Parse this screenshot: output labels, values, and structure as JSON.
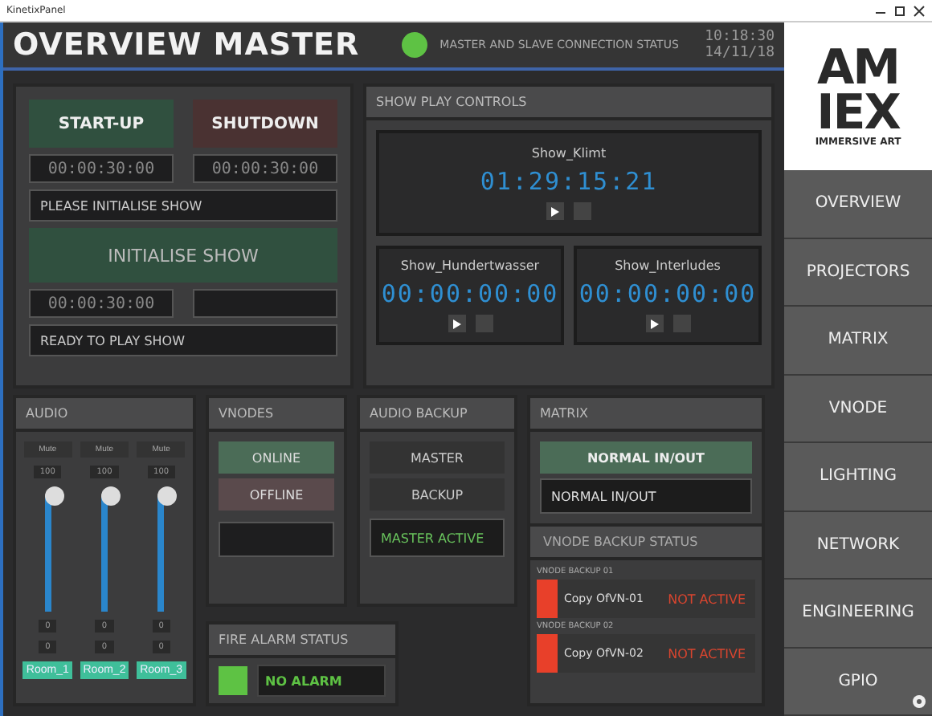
{
  "window": {
    "title": "KinetixPanel"
  },
  "header": {
    "title": "OVERVIEW MASTER",
    "connection_label": "MASTER AND SLAVE CONNECTION STATUS",
    "connected": true,
    "time": "10:18:30",
    "date": "14/11/18"
  },
  "logo": {
    "line1": "AM",
    "line2": "IEX",
    "tagline": "IMMERSIVE ART"
  },
  "nav": [
    {
      "label": "OVERVIEW",
      "selected": false
    },
    {
      "label": "PROJECTORS",
      "selected": false
    },
    {
      "label": "MATRIX",
      "selected": false
    },
    {
      "label": "VNODE",
      "selected": false
    },
    {
      "label": "LIGHTING",
      "selected": false
    },
    {
      "label": "NETWORK",
      "selected": false
    },
    {
      "label": "ENGINEERING",
      "selected": false
    },
    {
      "label": "GPIO",
      "selected": false
    }
  ],
  "power": {
    "startup": {
      "label": "START-UP",
      "timer": "00:00:30:00"
    },
    "shutdown": {
      "label": "SHUTDOWN",
      "timer": "00:00:30:00"
    },
    "message": "PLEASE INITIALISE SHOW",
    "initialise": {
      "label": "INITIALISE SHOW",
      "timer": "00:00:30:00"
    },
    "status": "READY TO PLAY SHOW"
  },
  "show_play": {
    "title": "SHOW PLAY CONTROLS",
    "shows": [
      {
        "name": "Show_Klimt",
        "timecode": "01:29:15:21"
      },
      {
        "name": "Show_Hundertwasser",
        "timecode": "00:00:00:00"
      },
      {
        "name": "Show_Interludes",
        "timecode": "00:00:00:00"
      }
    ]
  },
  "audio": {
    "title": "AUDIO",
    "channels": [
      {
        "mute": "Mute",
        "max": "100",
        "level": 1,
        "value": "0",
        "gain": "0",
        "name": "Room_1"
      },
      {
        "mute": "Mute",
        "max": "100",
        "level": 1,
        "value": "0",
        "gain": "0",
        "name": "Room_2"
      },
      {
        "mute": "Mute",
        "max": "100",
        "level": 1,
        "value": "0",
        "gain": "0",
        "name": "Room_3"
      }
    ]
  },
  "vnodes": {
    "title": "VNODES",
    "online": "ONLINE",
    "offline": "OFFLINE"
  },
  "audio_backup": {
    "title": "AUDIO BACKUP",
    "master": "MASTER",
    "backup": "BACKUP",
    "status": "MASTER ACTIVE"
  },
  "matrix": {
    "title": "MATRIX",
    "button": "NORMAL IN/OUT",
    "status": "NORMAL IN/OUT"
  },
  "vnode_backup": {
    "title": "VNODE BACKUP STATUS",
    "items": [
      {
        "label": "VNODE BACKUP 01",
        "name": "Copy OfVN-01",
        "status": "NOT ACTIVE",
        "color": "#e8402a"
      },
      {
        "label": "VNODE BACKUP 02",
        "name": "Copy OfVN-02",
        "status": "NOT ACTIVE",
        "color": "#e8402a"
      }
    ]
  },
  "fire_alarm": {
    "title": "FIRE ALARM STATUS",
    "status": "NO ALARM",
    "color": "#5ec244"
  }
}
